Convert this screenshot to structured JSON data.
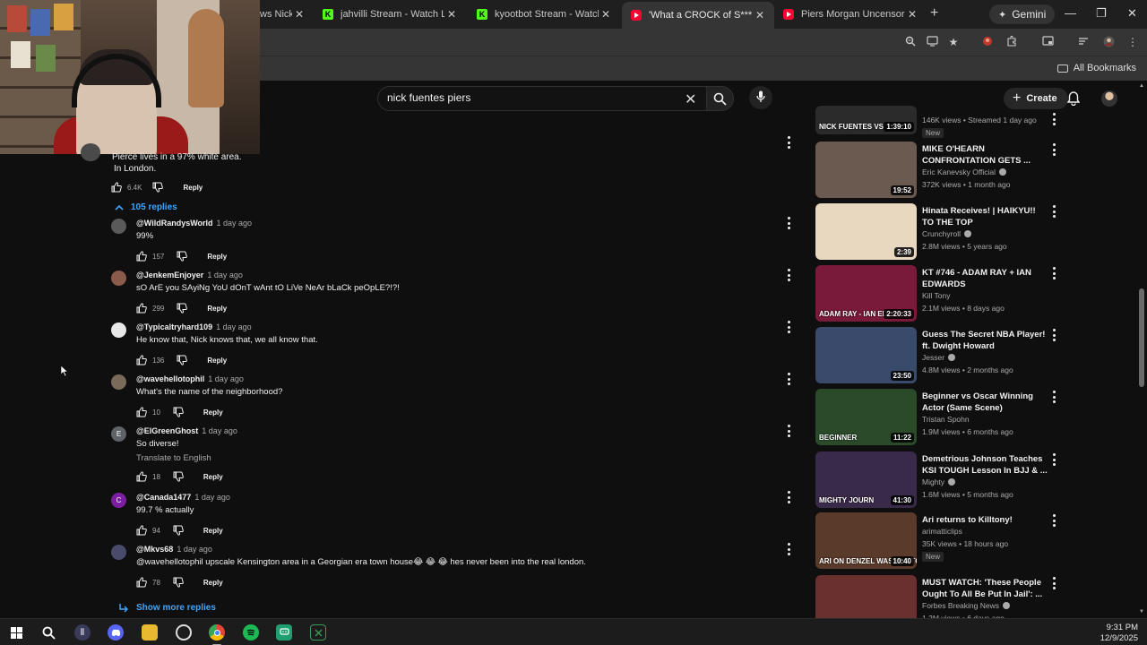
{
  "browser": {
    "tabs": [
      {
        "title": "ws Nick",
        "favicon": "none",
        "active": false
      },
      {
        "title": "jahvilli Stream - Watch Live o",
        "favicon": "kick",
        "active": false
      },
      {
        "title": "kyootbot Stream - Watch Live",
        "favicon": "kick",
        "active": false
      },
      {
        "title": "'What a CROCK of S***!' Piers",
        "favicon": "youtube",
        "active": true
      },
      {
        "title": "Piers Morgan Uncensored - Y",
        "favicon": "youtube",
        "active": false
      }
    ],
    "new_tab": "+",
    "gemini_label": "Gemini",
    "all_bookmarks": "All Bookmarks"
  },
  "youtube": {
    "search_value": "nick fuentes piers",
    "create_label": "Create",
    "accent": "#3ea6ff"
  },
  "comments": {
    "parent_text_line1": "Pierce lives in a 97% white area.",
    "parent_text_line2": "In London.",
    "parent_likes": "6.4K",
    "reply_label": "Reply",
    "replies_toggle": "105 replies",
    "show_more": "Show more replies",
    "translate_label": "Translate to English",
    "replies": [
      {
        "author": "@WildRandysWorld",
        "time": "1 day ago",
        "text": "99%",
        "likes": "157",
        "avatar_letter": "",
        "avatar_color": "#5a5a5a"
      },
      {
        "author": "@JenkemEnjoyer",
        "time": "1 day ago",
        "text": "sO ArE you SAyiNg YoU dOnT wAnt tO LiVe NeAr bLaCk peOpLE?!?!",
        "likes": "299",
        "avatar_letter": "",
        "avatar_color": "#8a5a4a"
      },
      {
        "author": "@Typicaltryhard109",
        "time": "1 day ago",
        "text": "He know that, Nick knows that, we all know that.",
        "likes": "136",
        "avatar_letter": "",
        "avatar_color": "#e8e8e8"
      },
      {
        "author": "@wavehellotophil",
        "time": "1 day ago",
        "text": "What's the name of the neighborhood?",
        "likes": "10",
        "avatar_letter": "",
        "avatar_color": "#7a6a5a"
      },
      {
        "author": "@ElGreenGhost",
        "time": "1 day ago",
        "text": "So diverse!",
        "likes": "18",
        "avatar_letter": "E",
        "avatar_color": "#5f6368",
        "translate": true
      },
      {
        "author": "@Canada1477",
        "time": "1 day ago",
        "text": "99.7 % actually",
        "likes": "94",
        "avatar_letter": "C",
        "avatar_color": "#7b1fa2"
      },
      {
        "author": "@Mkvs68",
        "time": "1 day ago",
        "text": "@wavehellotophil upscale Kensington area in a Georgian era town house😂 😂 😂  hes never been into the real london.",
        "likes": "78",
        "avatar_letter": "",
        "avatar_color": "#4a4a6a"
      }
    ]
  },
  "sidebar": {
    "videos": [
      {
        "title": "",
        "channel": "",
        "meta": "146K views • Streamed 1 day ago",
        "badge": "New",
        "duration": "1:39:10",
        "thumb_text": "NICK FUENTES VS",
        "thumb_color": "#2b2b2b",
        "verified": false
      },
      {
        "title": "MIKE O'HEARN CONFRONTATION GETS ...",
        "channel": "Eric Kanevsky Official",
        "meta": "372K views • 1 month ago",
        "badge": "",
        "duration": "19:52",
        "thumb_text": "",
        "thumb_color": "#6b5a50",
        "verified": true
      },
      {
        "title": "Hinata Receives! | HAIKYU!! TO THE TOP",
        "channel": "Crunchyroll",
        "meta": "2.8M views • 5 years ago",
        "badge": "",
        "duration": "2:39",
        "thumb_text": "",
        "thumb_color": "#e8d8c0",
        "verified": true
      },
      {
        "title": "KT #746 - ADAM RAY + IAN EDWARDS",
        "channel": "Kill Tony",
        "meta": "2.1M views • 8 days ago",
        "badge": "",
        "duration": "2:20:33",
        "thumb_text": "ADAM RAY - IAN ED",
        "thumb_color": "#7a1a3a",
        "verified": false
      },
      {
        "title": "Guess The Secret NBA Player! ft. Dwight Howard",
        "channel": "Jesser",
        "meta": "4.8M views • 2 months ago",
        "badge": "",
        "duration": "23:50",
        "thumb_text": "",
        "thumb_color": "#3a4a6a",
        "verified": true
      },
      {
        "title": "Beginner vs Oscar Winning Actor (Same Scene)",
        "channel": "Tristan Spohn",
        "meta": "1.9M views • 6 months ago",
        "badge": "",
        "duration": "11:22",
        "thumb_text": "BEGINNER",
        "thumb_color": "#2a4a2a",
        "verified": false
      },
      {
        "title": "Demetrious Johnson Teaches KSI TOUGH Lesson In BJJ & ...",
        "channel": "Mighty",
        "meta": "1.6M views • 5 months ago",
        "badge": "",
        "duration": "41:30",
        "thumb_text": "MIGHTY JOURN",
        "thumb_color": "#3a2a4a",
        "verified": true
      },
      {
        "title": "Ari returns to Killtony!",
        "channel": "arimatticlips",
        "meta": "35K views • 18 hours ago",
        "badge": "New",
        "duration": "10:40",
        "thumb_text": "ARI ON DENZEL WASHINGTON AND",
        "thumb_color": "#5a3a2a",
        "verified": false
      },
      {
        "title": "MUST WATCH: 'These People Ought To All Be Put In Jail': ...",
        "channel": "Forbes Breaking News",
        "meta": "1.2M views • 6 days ago",
        "badge": "",
        "duration": "",
        "thumb_text": "",
        "thumb_color": "#6a3030",
        "verified": true
      }
    ]
  },
  "taskbar": {
    "time": "9:31 PM",
    "date": "12/9/2025"
  }
}
